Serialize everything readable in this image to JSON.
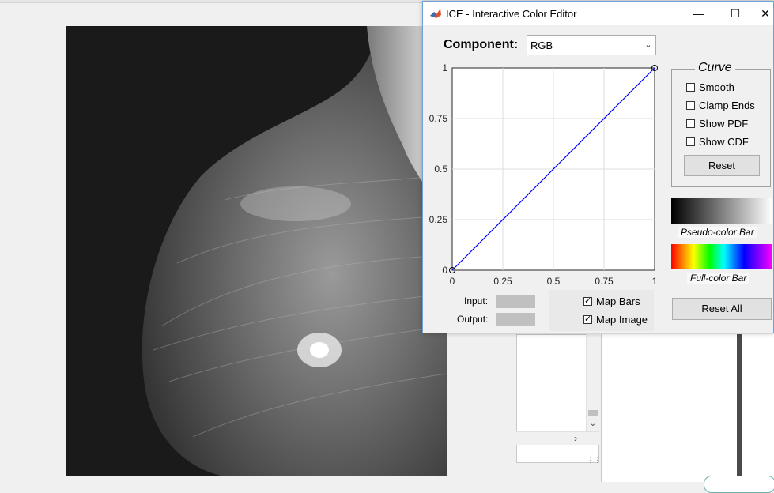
{
  "dialog": {
    "title": "ICE - Interactive Color Editor",
    "component_label": "Component:",
    "component_value": "RGB"
  },
  "plot": {
    "y_ticks": [
      "1",
      "0.75",
      "0.5",
      "0.25",
      "0"
    ],
    "x_ticks": [
      "0",
      "0.25",
      "0.5",
      "0.75",
      "1"
    ],
    "line_color": "#0000ff"
  },
  "chart_data": {
    "type": "line",
    "x": [
      0,
      1
    ],
    "series": [
      {
        "values": [
          0,
          1
        ]
      }
    ],
    "xlim": [
      0,
      1
    ],
    "ylim": [
      0,
      1
    ],
    "grid": true
  },
  "io": {
    "input_label": "Input:",
    "output_label": "Output:"
  },
  "map": {
    "bars_label": "Map Bars",
    "bars_checked": true,
    "image_label": "Map Image",
    "image_checked": true
  },
  "curve": {
    "legend": "Curve",
    "options": [
      {
        "label": "Smooth",
        "checked": false
      },
      {
        "label": "Clamp Ends",
        "checked": false
      },
      {
        "label": "Show PDF",
        "checked": false
      },
      {
        "label": "Show CDF",
        "checked": false
      }
    ],
    "reset_label": "Reset"
  },
  "bars": {
    "pseudo_label": "Pseudo-color Bar",
    "full_label": "Full-color Bar"
  },
  "reset_all_label": "Reset All"
}
